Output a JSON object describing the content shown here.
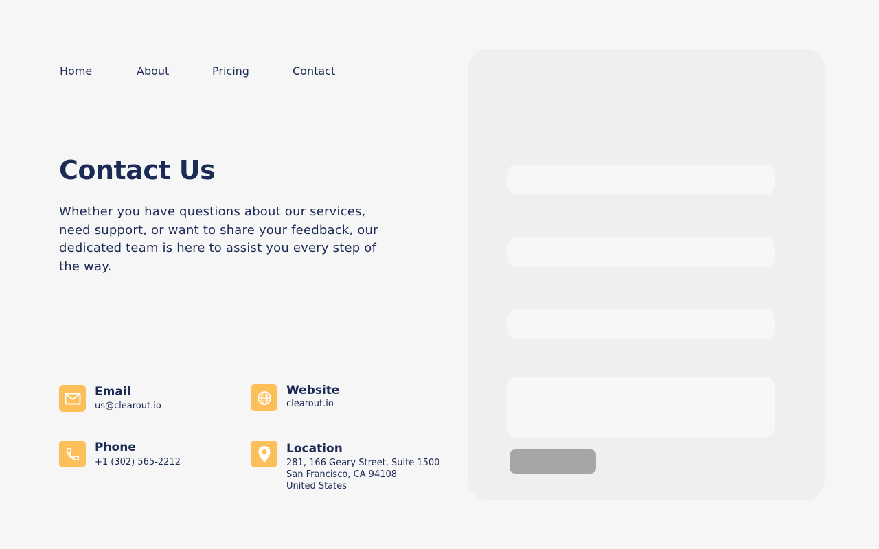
{
  "nav": {
    "items": [
      {
        "label": "Home"
      },
      {
        "label": "About"
      },
      {
        "label": "Pricing"
      },
      {
        "label": "Contact"
      }
    ]
  },
  "hero": {
    "title": "Contact Us",
    "description": "Whether you have questions about our services, need support, or want to share your feedback, our dedicated team is here to assist you every step of the way."
  },
  "contact_info": {
    "email": {
      "label": "Email",
      "value": "us@clearout.io",
      "icon": "envelope-icon"
    },
    "website": {
      "label": "Website",
      "value": "clearout.io",
      "icon": "globe-icon"
    },
    "phone": {
      "label": "Phone",
      "value": "+1 (302) 565-2212",
      "icon": "phone-icon"
    },
    "location": {
      "label": "Location",
      "lines": [
        "281, 166 Geary Street, Suite 1500",
        "San Francisco, CA 94108",
        "United States"
      ],
      "icon": "map-pin-icon"
    }
  },
  "colors": {
    "accent": "#fdbf5a",
    "text": "#1c2a56",
    "panel": "#efefef",
    "field": "#f7f7f7",
    "button": "#a6a6a6"
  }
}
